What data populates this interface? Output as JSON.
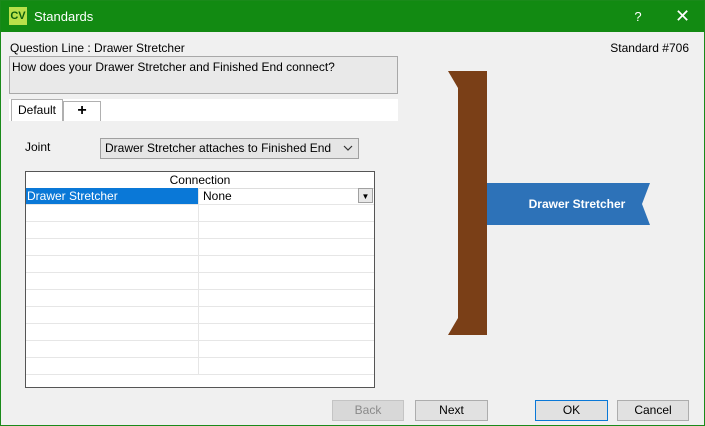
{
  "window": {
    "app_icon": "CV",
    "title": "Standards",
    "help": "?",
    "close": "✕"
  },
  "header": {
    "question_line": "Question Line : Drawer Stretcher",
    "standard": "Standard #706",
    "question_text": "How does your Drawer Stretcher and Finished End connect?"
  },
  "tabs": {
    "default_label": "Default",
    "add_label": "+"
  },
  "joint": {
    "label": "Joint",
    "value": "Drawer Stretcher attaches to Finished End"
  },
  "connection_grid": {
    "header": "Connection",
    "rows": [
      {
        "name": "Drawer Stretcher",
        "value": "None"
      }
    ]
  },
  "diagram": {
    "part_label": "Drawer Stretcher",
    "end_color": "#7a3f17",
    "part_color": "#2d72b8"
  },
  "buttons": {
    "back": "Back",
    "next": "Next",
    "ok": "OK",
    "cancel": "Cancel"
  }
}
